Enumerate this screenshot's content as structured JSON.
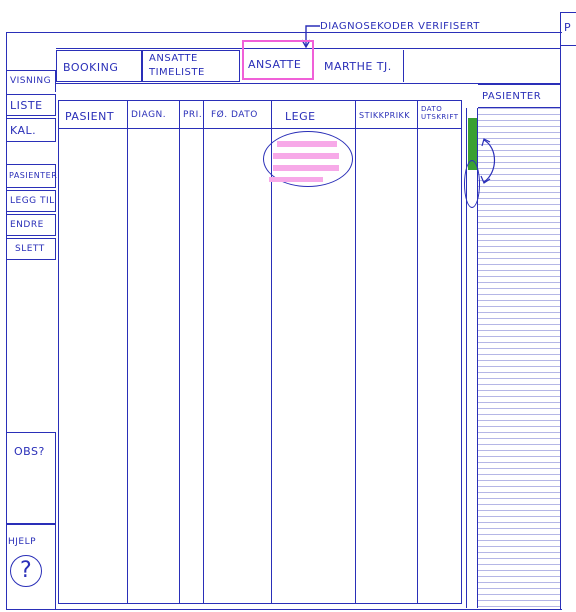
{
  "annotation": {
    "text": "DIAGNOSEKODER VERIFISERT"
  },
  "top_tabs": [
    {
      "label": "BOOKING"
    },
    {
      "label": "ANSATTE TIMELISTE"
    },
    {
      "label": "ANSATTE"
    },
    {
      "label": "MARTHE TJ."
    }
  ],
  "sidebar": {
    "items": [
      {
        "label": "VISNING"
      },
      {
        "label": "LISTE"
      },
      {
        "label": "KAL."
      },
      {
        "label": "PASIENTER"
      },
      {
        "label": "LEGG TIL"
      },
      {
        "label": "ENDRE"
      },
      {
        "label": "SLETT"
      }
    ],
    "obs_label": "OBS?",
    "help_label": "HJELP",
    "help_symbol": "?"
  },
  "table": {
    "columns": [
      "PASIENT",
      "DIAGN.",
      "PRI.",
      "FØ. DATO",
      "LEGE",
      "STIKKPRIKK",
      "DATO UTSKRIFT"
    ]
  },
  "right_panel": {
    "title": "PASIENTER"
  },
  "corner_label": "P",
  "colors": {
    "ink": "#2a2fb8",
    "highlight": "#f7a9e8",
    "scroll_thumb": "#3aa032"
  }
}
